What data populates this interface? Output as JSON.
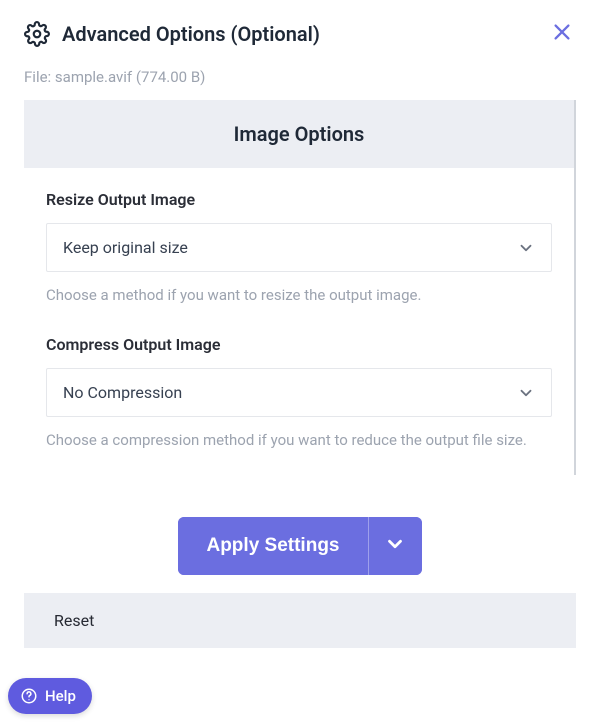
{
  "header": {
    "title": "Advanced Options (Optional)"
  },
  "file": {
    "label": "File:",
    "name": "sample.avif",
    "size": "(774.00 B)"
  },
  "panel": {
    "section_title": "Image Options",
    "resize": {
      "label": "Resize Output Image",
      "value": "Keep original size",
      "help": "Choose a method if you want to resize the output image."
    },
    "compress": {
      "label": "Compress Output Image",
      "value": "No Compression",
      "help": "Choose a compression method if you want to reduce the output file size."
    }
  },
  "actions": {
    "apply": "Apply Settings",
    "reset": "Reset"
  },
  "help": {
    "label": "Help"
  }
}
